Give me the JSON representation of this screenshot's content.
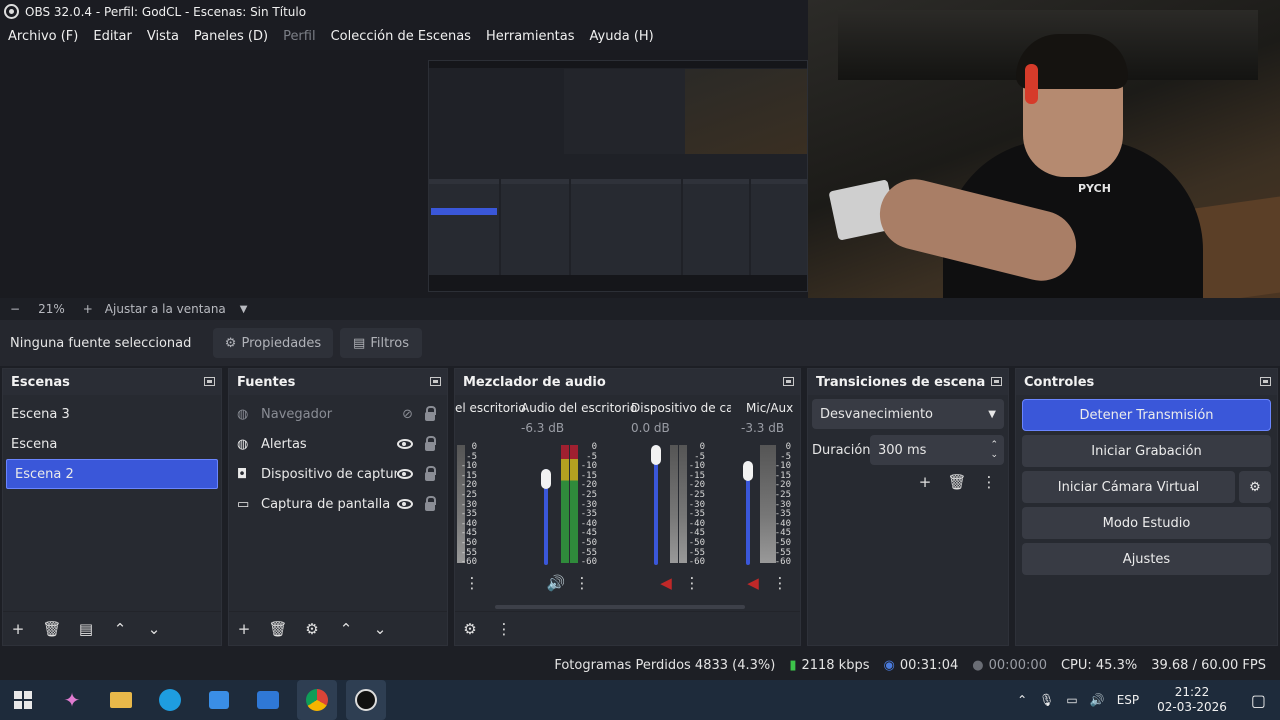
{
  "window": {
    "title": "OBS 32.0.4 - Perfil: GodCL - Escenas: Sin Título"
  },
  "menu": [
    "Archivo (F)",
    "Editar",
    "Vista",
    "Paneles (D)",
    "Perfil",
    "Colección de Escenas",
    "Herramientas",
    "Ayuda (H)"
  ],
  "zoom": {
    "minus": "−",
    "value": "21%",
    "plus": "+",
    "fit": "Ajustar a la ventana"
  },
  "propbar": {
    "source_label": "Ninguna fuente seleccionad",
    "properties": "Propiedades",
    "filters": "Filtros"
  },
  "scenes": {
    "title": "Escenas",
    "items": [
      "Escena 3",
      "Escena",
      "Escena 2"
    ],
    "selected": "Escena 2"
  },
  "sources": {
    "title": "Fuentes",
    "items": [
      "Navegador",
      "Alertas",
      "Dispositivo de captura",
      "Captura de pantalla"
    ]
  },
  "mixer": {
    "title": "Mezclador de audio",
    "channels": [
      {
        "name": "el escritorio",
        "db": ""
      },
      {
        "name": "Audio del escritorio",
        "db": "-6.3 dB"
      },
      {
        "name": "Dispositivo de capt",
        "db": "0.0 dB"
      },
      {
        "name": "Mic/Aux",
        "db": "-3.3 dB"
      }
    ],
    "scale": [
      "0",
      "-5",
      "-10",
      "-15",
      "-20",
      "-25",
      "-30",
      "-35",
      "-40",
      "-45",
      "-50",
      "-55",
      "-60"
    ]
  },
  "transitions": {
    "title": "Transiciones de escena",
    "selected": "Desvanecimiento",
    "duration_label": "Duración",
    "duration_value": "300 ms"
  },
  "controls": {
    "title": "Controles",
    "buttons": [
      "Detener Transmisión",
      "Iniciar Grabación",
      "Iniciar Cámara Virtual",
      "Modo Estudio",
      "Ajustes"
    ]
  },
  "status": {
    "dropped": "Fotogramas Perdidos 4833 (4.3%)",
    "bitrate": "2118 kbps",
    "stream_time": "00:31:04",
    "rec_time": "00:00:00",
    "cpu": "CPU: 45.3%",
    "fps": "39.68 / 60.00 FPS"
  },
  "webcam": {
    "shirt_text": "PYCH"
  },
  "taskbar": {
    "lang": "ESP",
    "time": "21:22",
    "date": "02-03-2026"
  },
  "colors": {
    "accent": "#3a57d9",
    "bg": "#272a31",
    "taskbar": "#1e2b3b"
  }
}
